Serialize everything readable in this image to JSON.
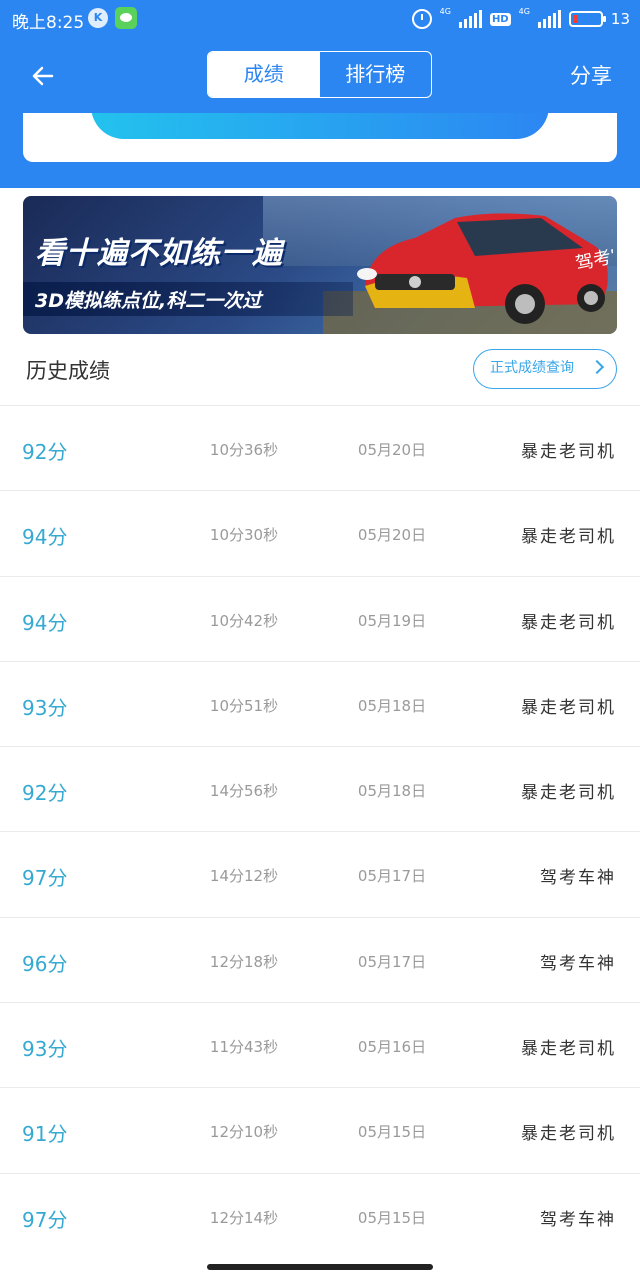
{
  "status_bar": {
    "time": "晚上8:25",
    "badge_k": "K",
    "net_label_1": "4G",
    "net_label_2": "4G",
    "hd": "HD",
    "battery": "13"
  },
  "header": {
    "tabs": [
      {
        "label": "成绩",
        "active": true
      },
      {
        "label": "排行榜",
        "active": false
      }
    ],
    "share_label": "分享",
    "accent_color": "#2c86f2"
  },
  "banner": {
    "headline": "看十遍不如练一遍",
    "subline": "3D模拟练点位,科二一次过",
    "car_text": "驾考宝典"
  },
  "history": {
    "title": "历史成绩",
    "query_button": "正式成绩查询",
    "rows": [
      {
        "score": "92分",
        "duration": "10分36秒",
        "date": "05月20日",
        "user": "暴走老司机"
      },
      {
        "score": "94分",
        "duration": "10分30秒",
        "date": "05月20日",
        "user": "暴走老司机"
      },
      {
        "score": "94分",
        "duration": "10分42秒",
        "date": "05月19日",
        "user": "暴走老司机"
      },
      {
        "score": "93分",
        "duration": "10分51秒",
        "date": "05月18日",
        "user": "暴走老司机"
      },
      {
        "score": "92分",
        "duration": "14分56秒",
        "date": "05月18日",
        "user": "暴走老司机"
      },
      {
        "score": "97分",
        "duration": "14分12秒",
        "date": "05月17日",
        "user": "驾考车神"
      },
      {
        "score": "96分",
        "duration": "12分18秒",
        "date": "05月17日",
        "user": "驾考车神"
      },
      {
        "score": "93分",
        "duration": "11分43秒",
        "date": "05月16日",
        "user": "暴走老司机"
      },
      {
        "score": "91分",
        "duration": "12分10秒",
        "date": "05月15日",
        "user": "暴走老司机"
      },
      {
        "score": "97分",
        "duration": "12分14秒",
        "date": "05月15日",
        "user": "驾考车神"
      }
    ]
  }
}
